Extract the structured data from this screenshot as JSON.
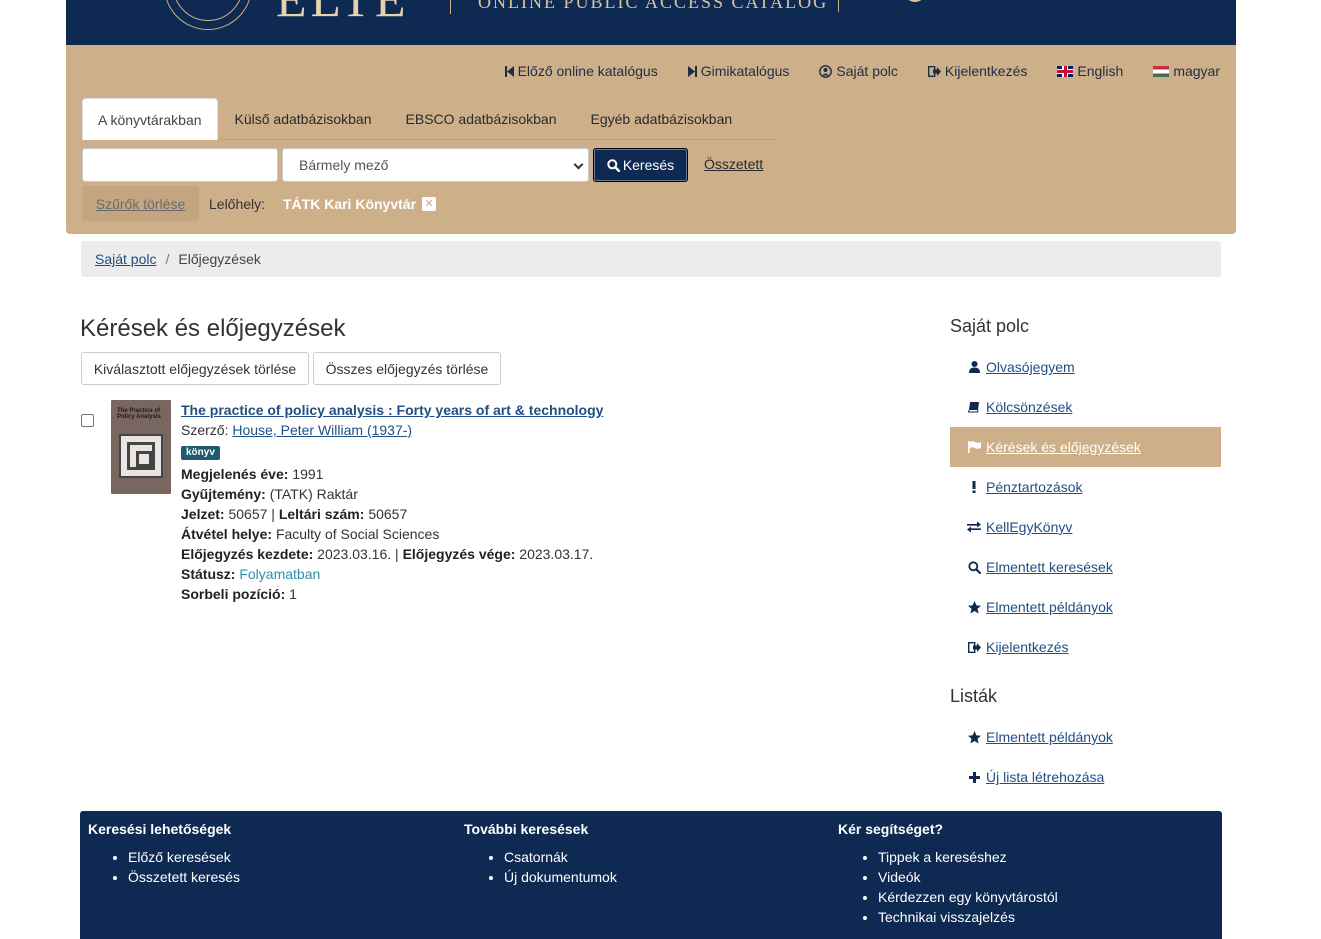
{
  "banner": {
    "logo_text": "ELTE",
    "subtitle": "ONLINE PUBLIC ACCESS CATALOG"
  },
  "topnav": [
    {
      "label": "Előző online katalógus",
      "icon": "skip-back-icon"
    },
    {
      "label": "Gimikatalógus",
      "icon": "skip-forward-icon"
    },
    {
      "label": "Saját polc",
      "icon": "user-circle-icon"
    },
    {
      "label": "Kijelentkezés",
      "icon": "sign-out-icon"
    },
    {
      "label": "English",
      "icon": "flag-uk-icon"
    },
    {
      "label": "magyar",
      "icon": "flag-hu-icon"
    }
  ],
  "tabs": [
    "A könyvtárakban",
    "Külső adatbázisokban",
    "EBSCO adatbázisokban",
    "Egyéb adatbázisokban"
  ],
  "search": {
    "input_value": "",
    "select_value": "Bármely mező",
    "button_label": "Keresés",
    "advanced_label": "Összetett"
  },
  "filters": {
    "clear_label": "Szűrők törlése",
    "label": "Lelőhely:",
    "value": "TÁTK Kari Könyvtár",
    "remove_glyph": "✕"
  },
  "breadcrumb": {
    "parent": "Saját polc",
    "separator": "/",
    "current": "Előjegyzések"
  },
  "main": {
    "title": "Kérések és előjegyzések",
    "delete_selected": "Kiválasztott előjegyzések törlése",
    "delete_all": "Összes előjegyzés törlése"
  },
  "hold": {
    "cover_title": "The Practice of Policy Analysis",
    "title": "The practice of policy analysis : Forty years of art & technology",
    "author_label": "Szerző:",
    "author": "House, Peter William (1937-)",
    "format": "könyv",
    "year_label": "Megjelenés éve:",
    "year": "1991",
    "collection_label": "Gyűjtemény:",
    "collection": "(TATK) Raktár",
    "callno_label": "Jelzet:",
    "callno": "50657",
    "inv_label": "Leltári szám:",
    "inv": "50657",
    "pickup_label": "Átvétel helye:",
    "pickup": "Faculty of Social Sciences",
    "start_label": "Előjegyzés kezdete:",
    "start": "2023.03.16.",
    "end_label": "Előjegyzés vége:",
    "end": "2023.03.17.",
    "status_label": "Státusz:",
    "status": "Folyamatban",
    "queue_label": "Sorbeli pozíció:",
    "queue": "1",
    "pipe": "|"
  },
  "sidebar": {
    "heading": "Saját polc",
    "items": [
      {
        "label": "Olvasójegyem",
        "icon": "user-icon"
      },
      {
        "label": "Kölcsönzések",
        "icon": "book-icon"
      },
      {
        "label": "Kérések és előjegyzések",
        "icon": "flag-icon",
        "active": true
      },
      {
        "label": "Pénztartozások",
        "icon": "exclamation-icon"
      },
      {
        "label": "KellEgyKönyv",
        "icon": "exchange-icon"
      },
      {
        "label": "Elmentett keresések",
        "icon": "search-icon"
      },
      {
        "label": "Elmentett példányok",
        "icon": "star-icon"
      },
      {
        "label": "Kijelentkezés",
        "icon": "sign-out-icon"
      }
    ],
    "lists_heading": "Listák",
    "lists": [
      {
        "label": "Elmentett példányok",
        "icon": "star-icon"
      },
      {
        "label": "Új lista létrehozása",
        "icon": "plus-icon"
      }
    ]
  },
  "footer": {
    "col1": {
      "heading": "Keresési lehetőségek",
      "links": [
        "Előző keresések",
        "Összetett keresés"
      ]
    },
    "col2": {
      "heading": "További keresések",
      "links": [
        "Csatornák",
        "Új dokumentumok"
      ]
    },
    "col3": {
      "heading": "Kér segítséget?",
      "links": [
        "Tippek a kereséshez",
        "Videók",
        "Kérdezzen egy könyvtárostól",
        "Technikai visszajelzés"
      ]
    }
  },
  "colors": {
    "navy": "#0e2a52",
    "tan": "#cdb08a",
    "link": "#1f4f86",
    "status": "#2f8fa5"
  }
}
